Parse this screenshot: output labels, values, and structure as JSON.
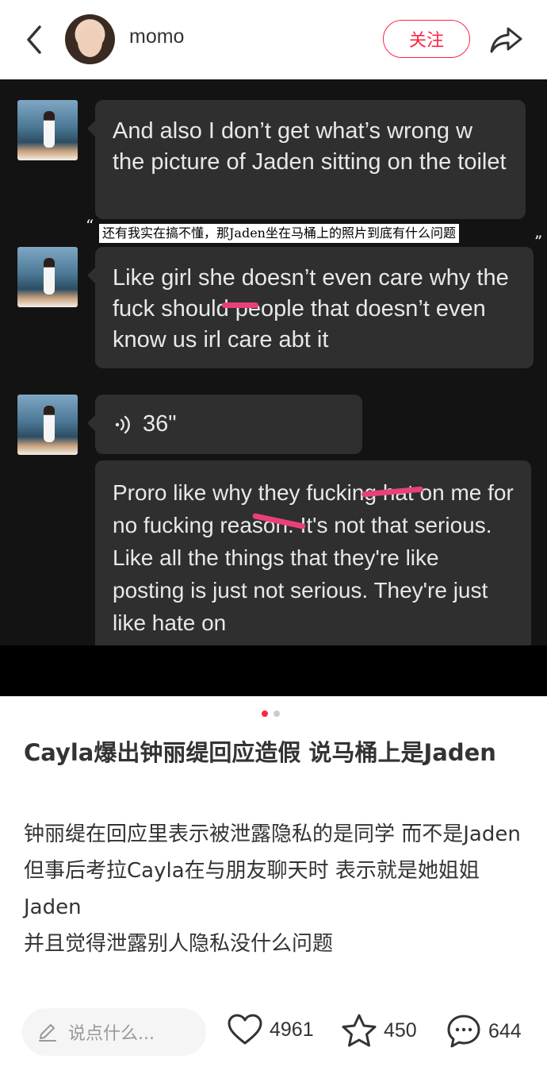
{
  "header": {
    "username": "momo",
    "follow_label": "关注"
  },
  "media": {
    "messages": [
      "And also I don’t get what’s wrong w the picture of Jaden sitting on the toilet",
      "Like girl she doesn’t even care why the fuck should people that doesn’t even know us irl care abt it",
      "Proro like why they fucking hat on me for no fucking reason. It's not that serious. Like all the things that they're like posting is just not serious. They're just like hate on"
    ],
    "voice_duration": "36\"",
    "caption": "还有我实在搞不懂，那Jaden坐在马桶上的照片到底有什么问题",
    "quote_open": "“",
    "quote_close": "”"
  },
  "pager": {
    "total": 2,
    "active": 1,
    "active_color": "#ff2442",
    "inactive_color": "#cccccc"
  },
  "post": {
    "title": "Cayla爆出钟丽缇回应造假 说马桶上是Jaden",
    "body": [
      "钟丽缇在回应里表示被泄露隐私的是同学 而不是Jaden",
      "但事后考拉Cayla在与朋友聊天时 表示就是她姐姐Jaden",
      "并且觉得泄露别人隐私没什么问题"
    ]
  },
  "bottom": {
    "comment_placeholder": "说点什么...",
    "likes": "4961",
    "collects": "450",
    "comments": "644"
  },
  "colors": {
    "accent": "#ff2442",
    "scribble": "#e8407a"
  }
}
